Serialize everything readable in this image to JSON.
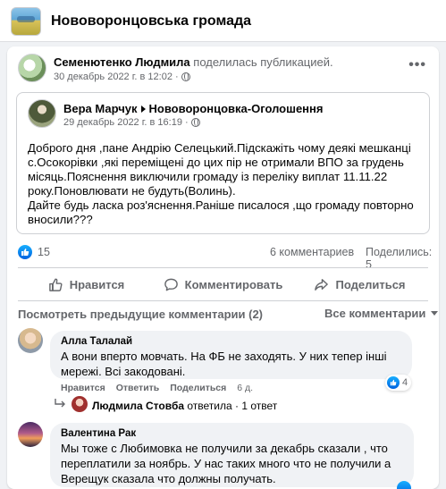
{
  "group": {
    "title": "Нововоронцовська громада"
  },
  "sharer": {
    "name": "Семенютенко Людмила",
    "action": "поделилась публикацией.",
    "time": "30 декабрь 2022 г. в 12:02 ·"
  },
  "original_post": {
    "author": "Вера Марчук",
    "group": "Нововоронцовка-Оголошення",
    "time": "29 декабрь 2022 г. в 16:19 ·",
    "text_lines": [
      "Доброго дня ,пане Андрію Селецький.Підскажіть чому деякі мешканці",
      "с.Осокорівки ,які переміщені до цих пір не отримали ВПО за грудень",
      "місяць.Пояснення виключили громаду із переліку виплат 11.11.22",
      "року.Поновлювати не будуть(Волинь).",
      "Дайте будь ласка роз'яснення.Раніше писалося ,що громаду повторно",
      "вносили???"
    ]
  },
  "stats": {
    "likes": "15",
    "comments": "6 комментариев",
    "shares": "Поделились: 5"
  },
  "actions": {
    "like": "Нравится",
    "comment": "Комментировать",
    "share": "Поделиться"
  },
  "comments_header": {
    "previous": "Посмотреть предыдущие комментарии (2)",
    "filter": "Все комментарии"
  },
  "comments": [
    {
      "author": "Алла Талалай",
      "lines": [
        "А вони вперто мовчать. На ФБ не заходять. У них тепер інші",
        "мережі. Всі закодовані."
      ],
      "like": "Нравится",
      "reply": "Ответить",
      "share": "Поделиться",
      "time": "6 д.",
      "reactions": "4",
      "reply_author": "Людмила Стовба",
      "reply_rest": "ответила · 1 ответ"
    },
    {
      "author": "Валентина Рак",
      "lines": [
        "Мы тоже с Любимовка не получили за декабрь сказали , что",
        "переплатили за ноябрь. У нас таких много что не получили а",
        "Верещук сказала что должны получать."
      ]
    }
  ],
  "colors": {
    "accent": "#1877f2",
    "muted": "#65676b",
    "bg": "#f0f2f5"
  }
}
